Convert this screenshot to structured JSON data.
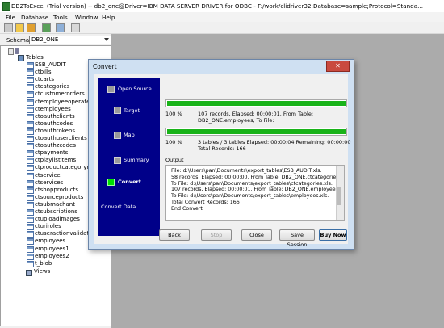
{
  "window": {
    "title": "DB2ToExcel (Trial version)   -- db2_one@Driver=IBM DATA SERVER DRIVER for ODBC - F:/work/clidriver32;Database=sample;Protocol=Standa..."
  },
  "menu": [
    "File",
    "Database",
    "Tools",
    "Window",
    "Help"
  ],
  "schema": {
    "label": "Schema",
    "value": "DB2_ONE"
  },
  "tree": {
    "tables_label": "Tables",
    "tables": [
      "ESB_AUDIT",
      "ctbills",
      "ctcarts",
      "ctcategories",
      "ctcustomerorders",
      "ctemployeeoperatelogs",
      "ctemployees",
      "ctoauthclients",
      "ctoauthcodes",
      "ctoauthtokens",
      "ctoauthuserclients",
      "ctoauthzcodes",
      "ctpayments",
      "ctplaylistitems",
      "ctproductcategoryrelatio",
      "ctservice",
      "ctservices",
      "ctshopproducts",
      "ctsourceproducts",
      "ctsubmachant",
      "ctsubscriptions",
      "ctuploadimages",
      "cturiroles",
      "ctuseractionvalidations",
      "employees",
      "employees1",
      "employees2",
      "t_blob"
    ],
    "views_label": "Views"
  },
  "dialog": {
    "title": "Convert",
    "close": "✕",
    "steps": [
      {
        "label": "Open Source",
        "active": false
      },
      {
        "label": "Target",
        "active": false
      },
      {
        "label": "Map",
        "active": false
      },
      {
        "label": "Summary",
        "active": false
      },
      {
        "label": "Convert",
        "active": true
      }
    ],
    "section_label": "Convert Data",
    "progress1": {
      "fraction": 1.0,
      "percent": "100 %",
      "line1": "107 records,      Elapsed: 00:00:01.     From Table:",
      "line2": "DB2_ONE.employees,      To File:"
    },
    "progress2": {
      "fraction": 1.0,
      "percent": "100 %",
      "line1": "3 tables / 3 tables     Elapsed: 00:00:04    Remaining: 00:00:00",
      "line2": "Total Records: 166"
    },
    "output_label": "Output",
    "output_lines": [
      "File: d:\\Users\\pan\\Documents\\export_tables\\ESB_AUDIT.xls.",
      "58 records,      Elapsed: 00:00:00.      From Table: DB2_ONE.ctcategories,",
      "To File: d:\\Users\\pan\\Documents\\export_tables\\ctcategories.xls.",
      "107 records,      Elapsed: 00:00:01.      From Table: DB2_ONE.employees,",
      "To File: d:\\Users\\pan\\Documents\\export_tables\\employees.xls.",
      "Total Convert Records: 166",
      "End Convert"
    ],
    "buttons": {
      "back": "Back",
      "stop": "Stop",
      "close": "Close",
      "save_session": "Save Session",
      "buy_now": "Buy Now"
    }
  }
}
